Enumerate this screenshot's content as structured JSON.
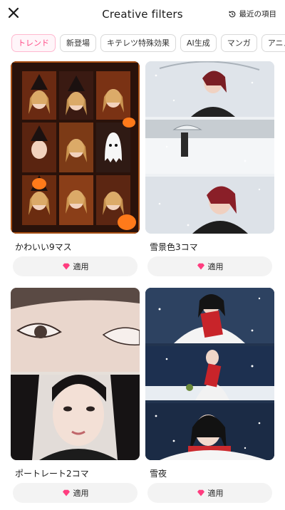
{
  "header": {
    "title": "Creative filters",
    "recent_label": "最近の項目"
  },
  "tabs": [
    {
      "label": "トレンド",
      "active": true
    },
    {
      "label": "新登場",
      "active": false
    },
    {
      "label": "キテレツ特殊効果",
      "active": false
    },
    {
      "label": "AI生成",
      "active": false
    },
    {
      "label": "マンガ",
      "active": false
    },
    {
      "label": "アニメ",
      "active": false
    }
  ],
  "cards": [
    {
      "title": "かわいい9マス",
      "button": "適用"
    },
    {
      "title": "雪景色3コマ",
      "button": "適用"
    },
    {
      "title": "ポートレート2コマ",
      "button": "適用"
    },
    {
      "title": "雪夜",
      "button": "適用"
    }
  ],
  "colors": {
    "accent": "#ff4a86",
    "gem": "#ff3d7f"
  }
}
